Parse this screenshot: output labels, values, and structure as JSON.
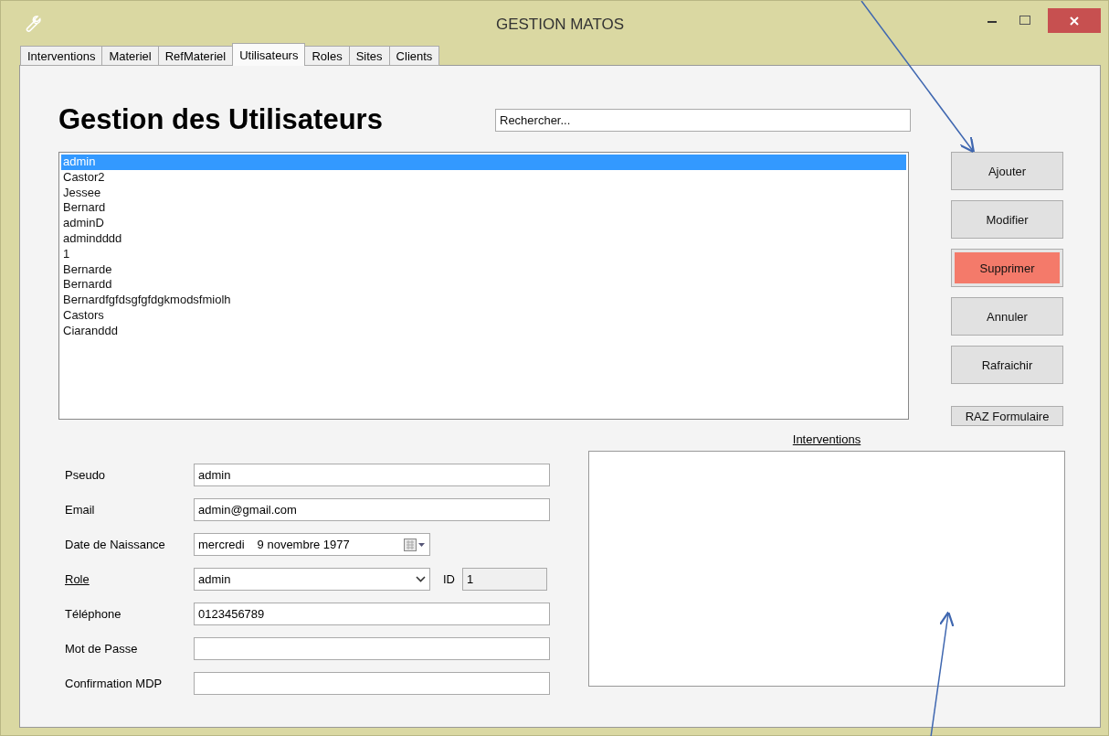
{
  "window": {
    "title": "GESTION MATOS"
  },
  "tabs": [
    {
      "label": "Interventions",
      "selected": false
    },
    {
      "label": "Materiel",
      "selected": false
    },
    {
      "label": "RefMateriel",
      "selected": false
    },
    {
      "label": "Utilisateurs",
      "selected": true
    },
    {
      "label": "Roles",
      "selected": false
    },
    {
      "label": "Sites",
      "selected": false
    },
    {
      "label": "Clients",
      "selected": false
    }
  ],
  "heading": "Gestion des Utilisateurs",
  "search": {
    "placeholder": "Rechercher..."
  },
  "users": [
    {
      "name": "admin",
      "selected": true
    },
    {
      "name": "Castor2",
      "selected": false
    },
    {
      "name": "Jessee",
      "selected": false
    },
    {
      "name": "Bernard",
      "selected": false
    },
    {
      "name": "adminD",
      "selected": false
    },
    {
      "name": "admindddd",
      "selected": false
    },
    {
      "name": "1",
      "selected": false
    },
    {
      "name": "Bernarde",
      "selected": false
    },
    {
      "name": "Bernardd",
      "selected": false
    },
    {
      "name": "Bernardfgfdsgfgfdgkmodsfmiolh",
      "selected": false
    },
    {
      "name": "Castors",
      "selected": false
    },
    {
      "name": "Ciaranddd",
      "selected": false
    }
  ],
  "buttons": [
    {
      "label": "Ajouter",
      "kind": "normal"
    },
    {
      "label": "Modifier",
      "kind": "normal"
    },
    {
      "label": "Supprimer",
      "kind": "danger"
    },
    {
      "label": "Annuler",
      "kind": "normal"
    },
    {
      "label": "Rafraichir",
      "kind": "normal"
    },
    {
      "label": "RAZ Formulaire",
      "kind": "small"
    }
  ],
  "form": [
    {
      "label": "Pseudo",
      "kind": "text",
      "value": "admin",
      "underlined": false
    },
    {
      "label": "Email",
      "kind": "text",
      "value": "admin@gmail.com",
      "underlined": false
    },
    {
      "label": "Date de Naissance",
      "kind": "date",
      "day": "mercredi",
      "value": "9 novembre 1977",
      "underlined": false
    },
    {
      "label": "Role",
      "kind": "combo",
      "value": "admin",
      "underlined": true,
      "id_label": "ID",
      "id_value": "1"
    },
    {
      "label": "Téléphone",
      "kind": "text",
      "value": "0123456789",
      "underlined": false
    },
    {
      "label": "Mot de Passe",
      "kind": "text",
      "underlined": false
    },
    {
      "label": "Confirmation MDP",
      "kind": "text",
      "underlined": false
    }
  ],
  "interventions": {
    "label": "Interventions"
  }
}
